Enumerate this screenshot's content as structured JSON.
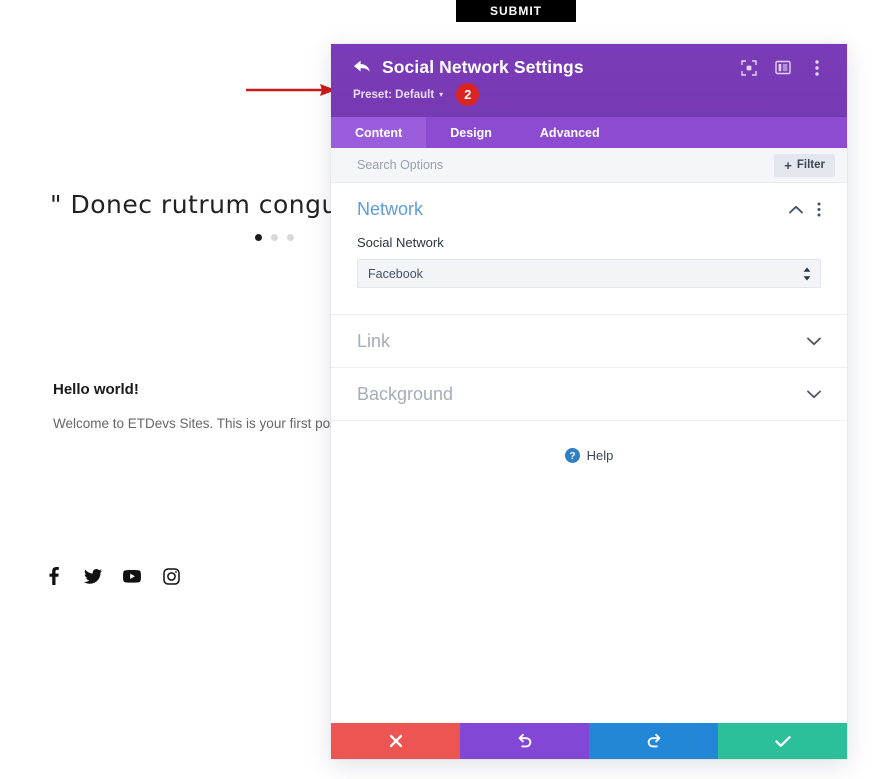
{
  "background_page": {
    "submit_button_label": "SUBMIT",
    "quote_text": "\" Donec rutrum congue leo e",
    "slider_dots": 3,
    "slider_active_index": 0,
    "post_title": "Hello world!",
    "post_excerpt": "Welcome to ETDevs Sites. This is your first post. E",
    "social_icons": [
      {
        "name": "facebook-icon",
        "glyph": "f"
      },
      {
        "name": "twitter-icon",
        "glyph": "t"
      },
      {
        "name": "youtube-icon",
        "glyph": "y"
      },
      {
        "name": "instagram-icon",
        "glyph": "i"
      }
    ]
  },
  "annotation": {
    "arrow_color": "#cc1a1a",
    "step_number": "2"
  },
  "modal": {
    "title": "Social Network Settings",
    "back_icon": "back-arrow-icon",
    "preset_label": "Preset: Default",
    "preset_caret": "▾",
    "header_tools": [
      {
        "name": "expand-icon"
      },
      {
        "name": "layout-columns-icon"
      },
      {
        "name": "more-options-icon"
      }
    ],
    "tabs": [
      {
        "label": "Content",
        "active": true
      },
      {
        "label": "Design",
        "active": false
      },
      {
        "label": "Advanced",
        "active": false
      }
    ],
    "search": {
      "value": "",
      "placeholder": "Search Options"
    },
    "filter_button": {
      "label": "Filter",
      "plus": "+"
    },
    "sections": [
      {
        "title": "Network",
        "open": true,
        "field_label": "Social Network",
        "select_value": "Facebook"
      },
      {
        "title": "Link",
        "open": false
      },
      {
        "title": "Background",
        "open": false
      }
    ],
    "help": {
      "label": "Help",
      "icon": "help-question-icon"
    },
    "footer_buttons": [
      {
        "name": "close-button",
        "icon": "close-x-icon",
        "color": "#ec5551"
      },
      {
        "name": "undo-button",
        "icon": "undo-arrow-icon",
        "color": "#8347d6"
      },
      {
        "name": "redo-button",
        "icon": "redo-arrow-icon",
        "color": "#2387d8"
      },
      {
        "name": "save-button",
        "icon": "checkmark-icon",
        "color": "#2bbf9a"
      }
    ]
  },
  "colors": {
    "header_purple": "#7a3ab5",
    "tabs_purple": "#8c4bd0",
    "tab_active_purple": "#9a5ddb",
    "section_active_blue": "#5b9ddb",
    "badge_red": "#d9241f"
  }
}
